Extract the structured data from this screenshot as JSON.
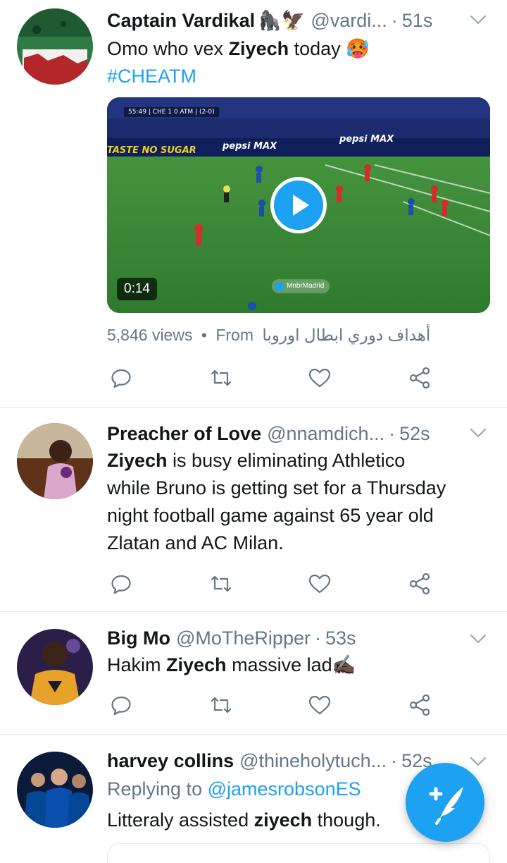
{
  "tweets": [
    {
      "name": "Captain Vardikal",
      "name_emoji": "🦍🦅",
      "handle": "@vardi...",
      "time": "51s",
      "text_parts": [
        "Omo who vex ",
        "Ziyech",
        " today 🥵"
      ],
      "hashtag": "#CHEATM",
      "video": {
        "duration": "0:14",
        "scoreboard": "55:49 | CHE 1 0 ATM | (2-0)",
        "watermark": "MnbrMadrid",
        "board_taste": "TASTE NO SUGAR",
        "board_pepsi": "pepsi MAX"
      },
      "views": "5,846 views",
      "from_label": "From",
      "from_source": "أهداف دوري ابطال اوروبا"
    },
    {
      "name": "Preacher of Love",
      "handle": "@nnamdich...",
      "time": "52s",
      "bold": "Ziyech",
      "text_lines": [
        " is busy eliminating Athletico",
        "while Bruno is getting set for a Thursday",
        "night football game against 65 year old",
        "Zlatan and AC Milan."
      ]
    },
    {
      "name": "Big Mo",
      "handle": "@MoTheRipper",
      "time": "53s",
      "text_parts": [
        "Hakim ",
        "Ziyech",
        " massive lad✍🏿"
      ]
    },
    {
      "name": "harvey collins",
      "handle": "@thineholytuch...",
      "time": "52s",
      "reply_label": "Replying to",
      "reply_to": "@jamesrobsonES",
      "text_parts": [
        "Litteraly assisted ",
        "ziyech",
        " though."
      ]
    }
  ],
  "separator": "·",
  "bullet": "•",
  "colors": {
    "accent": "#1da1f2",
    "muted": "#657786",
    "text": "#14171a",
    "divider": "#e1e8ed"
  },
  "icons": [
    "reply-icon",
    "retweet-icon",
    "like-icon",
    "share-icon",
    "chevron-down-icon",
    "compose-icon",
    "play-icon"
  ]
}
